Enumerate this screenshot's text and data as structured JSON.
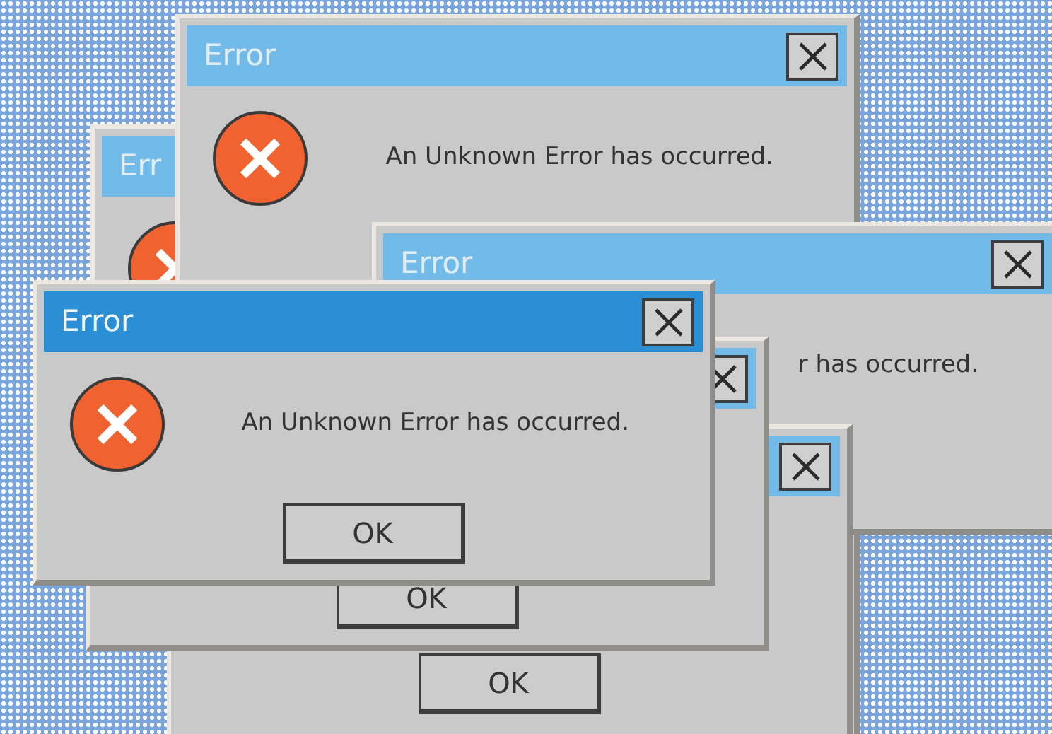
{
  "windows": [
    {
      "title": "Err",
      "active": false
    },
    {
      "title": "Error",
      "active": false,
      "message": "An Unknown Error has occurred."
    },
    {
      "title": "Error",
      "active": false,
      "message": "r has occurred."
    },
    {
      "active": false,
      "button": "OK"
    },
    {
      "active": false,
      "button": "OK"
    },
    {
      "title": "Error",
      "active": true,
      "message": "An Unknown Error has occurred.",
      "button": "OK"
    }
  ]
}
